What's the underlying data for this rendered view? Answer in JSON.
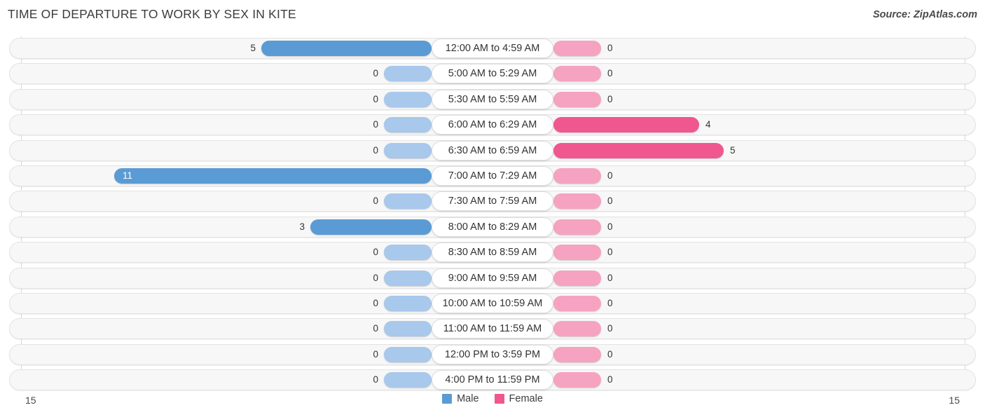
{
  "header": {
    "title": "TIME OF DEPARTURE TO WORK BY SEX IN KITE",
    "source": "Source: ZipAtlas.com"
  },
  "legend": {
    "male_label": "Male",
    "female_label": "Female",
    "male_color": "#5b9bd5",
    "female_color": "#f0578f"
  },
  "axis": {
    "left_label": "15",
    "right_label": "15"
  },
  "chart_data": {
    "type": "bar",
    "title": "TIME OF DEPARTURE TO WORK BY SEX IN KITE",
    "subtitle": "Source: ZipAtlas.com",
    "orientation": "horizontal-diverging",
    "xlabel": "",
    "ylabel": "",
    "xlim": [
      15,
      15
    ],
    "grid": true,
    "legend_position": "bottom-center",
    "categories": [
      "12:00 AM to 4:59 AM",
      "5:00 AM to 5:29 AM",
      "5:30 AM to 5:59 AM",
      "6:00 AM to 6:29 AM",
      "6:30 AM to 6:59 AM",
      "7:00 AM to 7:29 AM",
      "7:30 AM to 7:59 AM",
      "8:00 AM to 8:29 AM",
      "8:30 AM to 8:59 AM",
      "9:00 AM to 9:59 AM",
      "10:00 AM to 10:59 AM",
      "11:00 AM to 11:59 AM",
      "12:00 PM to 3:59 PM",
      "4:00 PM to 11:59 PM"
    ],
    "series": [
      {
        "name": "Male",
        "color": "#5b9bd5",
        "values": [
          5,
          0,
          0,
          0,
          0,
          11,
          0,
          3,
          0,
          0,
          0,
          0,
          0,
          0
        ]
      },
      {
        "name": "Female",
        "color": "#f0578f",
        "values": [
          0,
          0,
          0,
          4,
          5,
          0,
          0,
          0,
          0,
          0,
          0,
          0,
          0,
          0
        ]
      }
    ]
  },
  "rows": [
    {
      "label": "12:00 AM to 4:59 AM",
      "male": "5",
      "female": "0"
    },
    {
      "label": "5:00 AM to 5:29 AM",
      "male": "0",
      "female": "0"
    },
    {
      "label": "5:30 AM to 5:59 AM",
      "male": "0",
      "female": "0"
    },
    {
      "label": "6:00 AM to 6:29 AM",
      "male": "0",
      "female": "4"
    },
    {
      "label": "6:30 AM to 6:59 AM",
      "male": "0",
      "female": "5"
    },
    {
      "label": "7:00 AM to 7:29 AM",
      "male": "11",
      "female": "0"
    },
    {
      "label": "7:30 AM to 7:59 AM",
      "male": "0",
      "female": "0"
    },
    {
      "label": "8:00 AM to 8:29 AM",
      "male": "3",
      "female": "0"
    },
    {
      "label": "8:30 AM to 8:59 AM",
      "male": "0",
      "female": "0"
    },
    {
      "label": "9:00 AM to 9:59 AM",
      "male": "0",
      "female": "0"
    },
    {
      "label": "10:00 AM to 10:59 AM",
      "male": "0",
      "female": "0"
    },
    {
      "label": "11:00 AM to 11:59 AM",
      "male": "0",
      "female": "0"
    },
    {
      "label": "12:00 PM to 3:59 PM",
      "male": "0",
      "female": "0"
    },
    {
      "label": "4:00 PM to 11:59 PM",
      "male": "0",
      "female": "0"
    }
  ]
}
